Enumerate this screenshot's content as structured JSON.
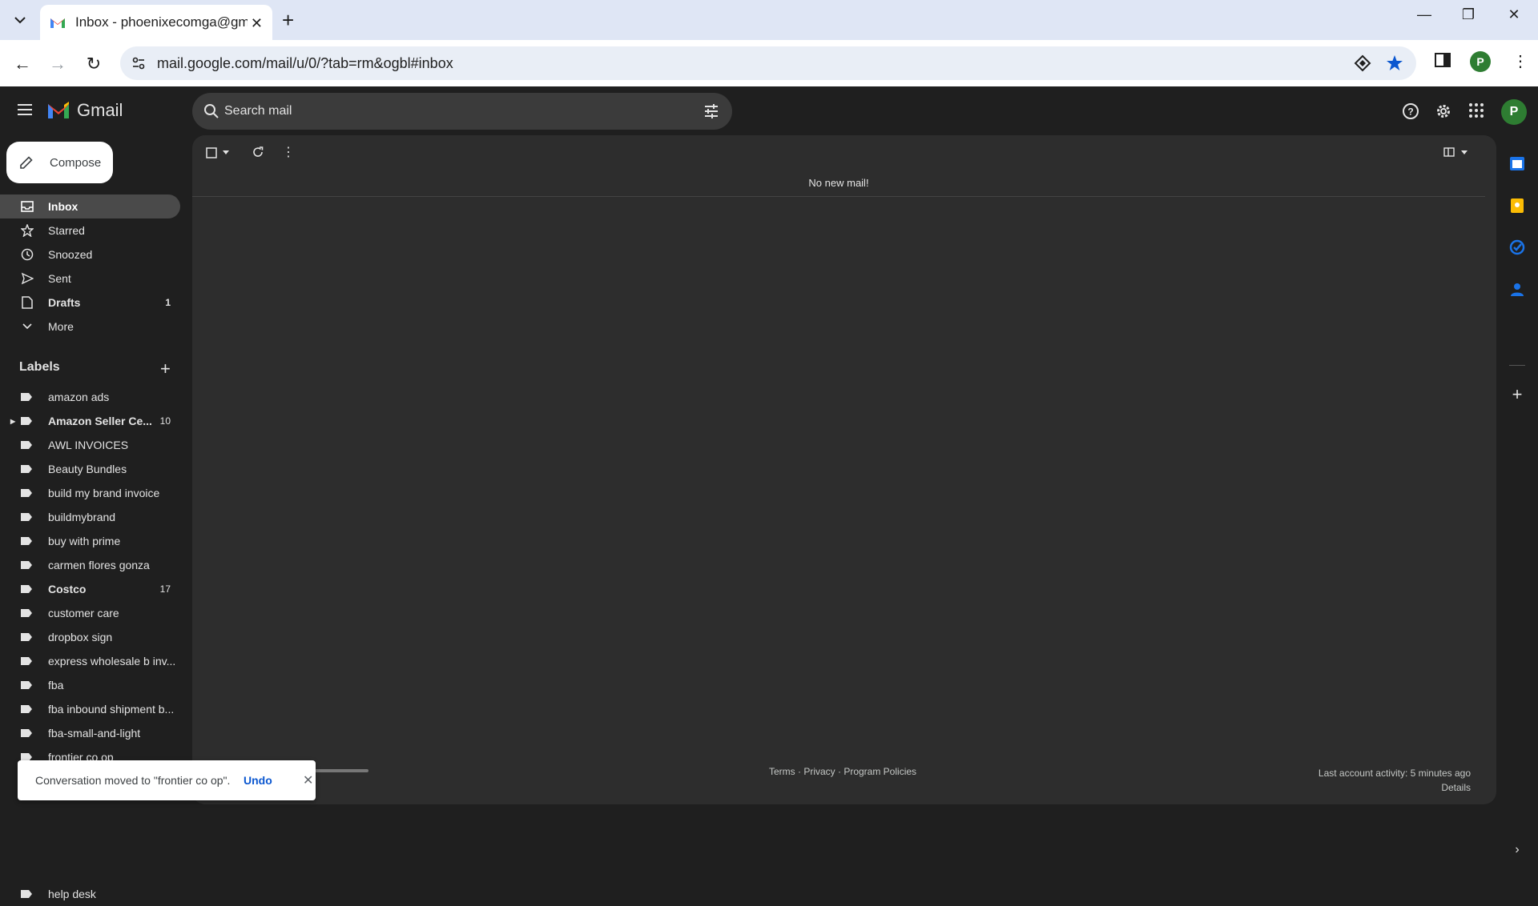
{
  "browser": {
    "tab_title": "Inbox - phoenixecomga@gmail.com",
    "url": "mail.google.com/mail/u/0/?tab=rm&ogbl#inbox",
    "profile_initial": "P"
  },
  "gmail": {
    "brand": "Gmail",
    "search_placeholder": "Search mail",
    "avatar_initial": "P",
    "compose_label": "Compose",
    "nav": [
      {
        "label": "Inbox",
        "count": ""
      },
      {
        "label": "Starred",
        "count": ""
      },
      {
        "label": "Snoozed",
        "count": ""
      },
      {
        "label": "Sent",
        "count": ""
      },
      {
        "label": "Drafts",
        "count": "1"
      },
      {
        "label": "More",
        "count": ""
      }
    ],
    "labels_heading": "Labels",
    "labels": [
      {
        "label": "amazon ads",
        "count": ""
      },
      {
        "label": "Amazon Seller Ce...",
        "count": "10"
      },
      {
        "label": "AWL INVOICES",
        "count": ""
      },
      {
        "label": "Beauty Bundles",
        "count": ""
      },
      {
        "label": "build my brand invoice",
        "count": ""
      },
      {
        "label": "buildmybrand",
        "count": ""
      },
      {
        "label": "buy with prime",
        "count": ""
      },
      {
        "label": "carmen flores gonza",
        "count": ""
      },
      {
        "label": "Costco",
        "count": "17"
      },
      {
        "label": "customer care",
        "count": ""
      },
      {
        "label": "dropbox sign",
        "count": ""
      },
      {
        "label": "express wholesale b inv...",
        "count": ""
      },
      {
        "label": "fba",
        "count": ""
      },
      {
        "label": "fba inbound shipment b...",
        "count": ""
      },
      {
        "label": "fba-small-and-light",
        "count": ""
      },
      {
        "label": "frontier co op",
        "count": ""
      }
    ],
    "help_desk_label": "help desk",
    "empty_message": "No new mail!",
    "footer_links": "Terms · Privacy · Program Policies",
    "last_activity": "Last account activity: 5 minutes ago",
    "details_link": "Details"
  },
  "snackbar": {
    "text": "Conversation moved to \"frontier co op\".",
    "undo": "Undo"
  }
}
